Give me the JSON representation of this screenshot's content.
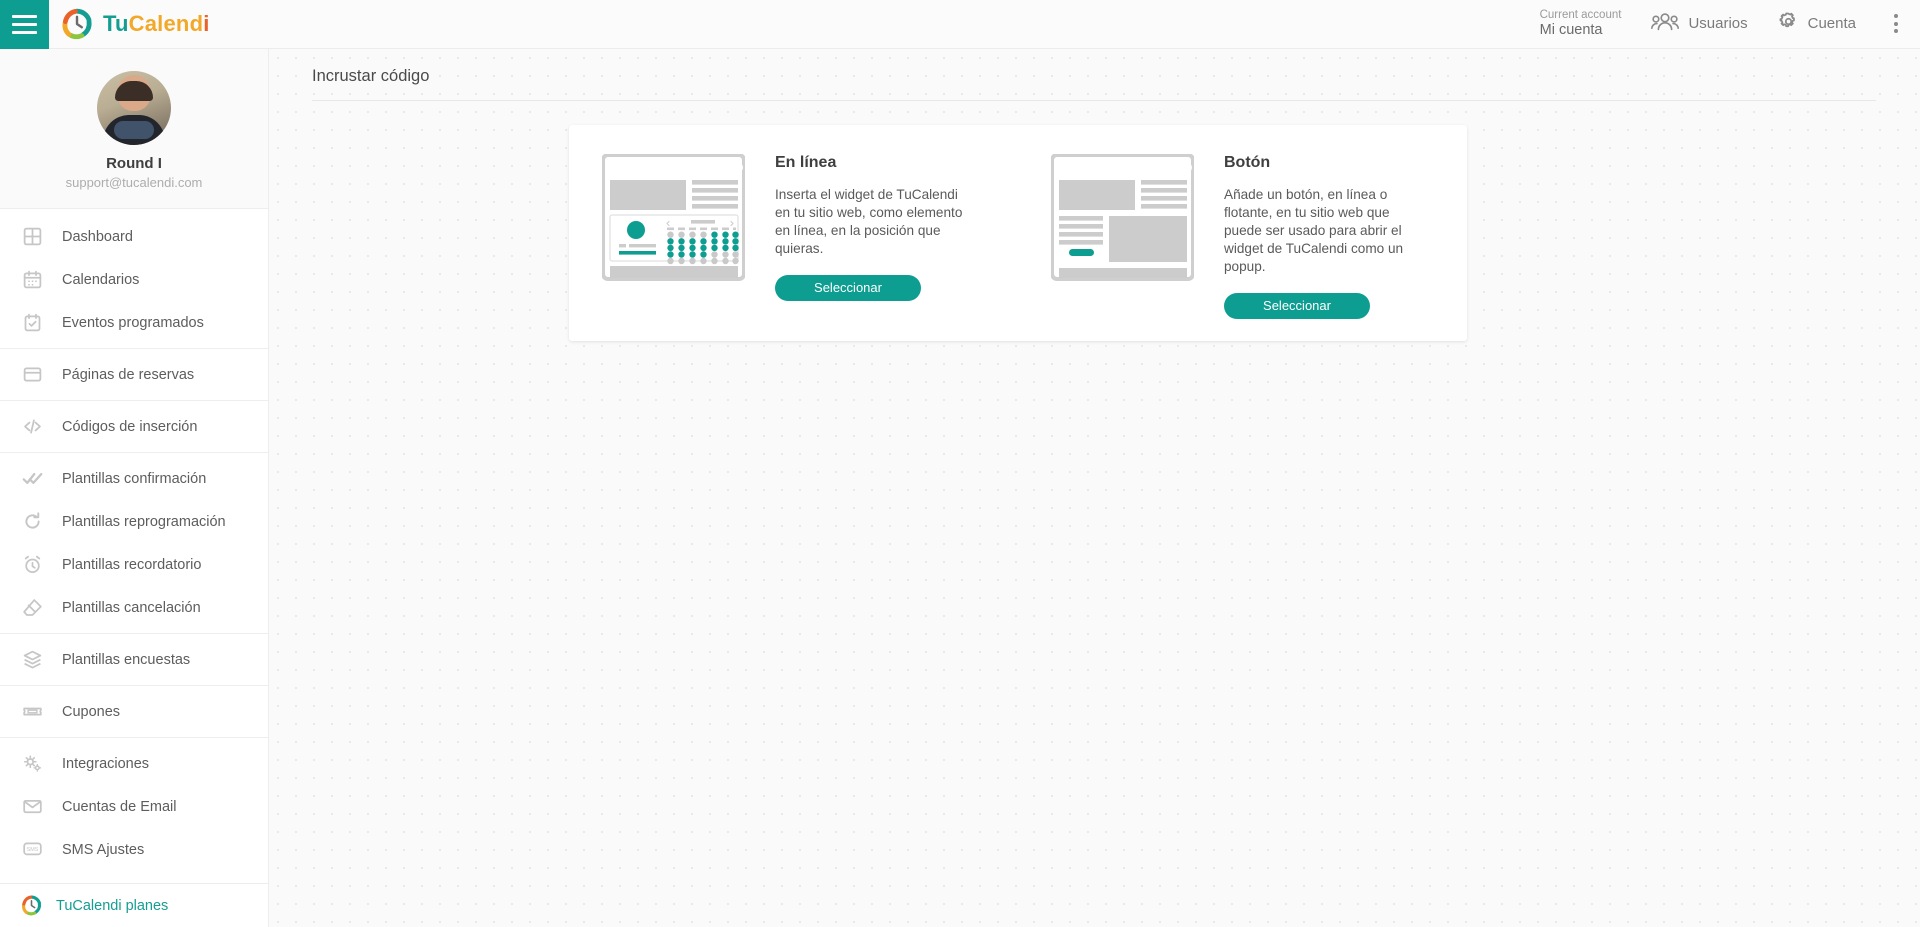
{
  "app": {
    "brand_tu": "Tu",
    "brand_calend": "Calend",
    "brand_i": "i",
    "accent_teal": "#0d9e91",
    "accent_orange": "#e8622a",
    "accent_yellow": "#f2a92a",
    "accent_green": "#8cc63f"
  },
  "topbar": {
    "menu_icon": "hamburger-icon",
    "logo_icon": "tucalendi-logo-icon",
    "current_account_label": "Current account",
    "current_account_value": "Mi cuenta",
    "users_label": "Usuarios",
    "users_icon": "users-icon",
    "account_label": "Cuenta",
    "account_icon": "gear-icon",
    "more_icon": "kebab-menu-icon"
  },
  "sidebar": {
    "profile": {
      "avatar_icon": "user-avatar",
      "name": "Round I",
      "email": "support@tucalendi.com"
    },
    "groups": [
      {
        "items": [
          {
            "label": "Dashboard",
            "icon": "dashboard-grid-icon"
          },
          {
            "label": "Calendarios",
            "icon": "calendar-icon"
          },
          {
            "label": "Eventos programados",
            "icon": "calendar-check-icon"
          }
        ]
      },
      {
        "items": [
          {
            "label": "Páginas de reservas",
            "icon": "window-icon"
          }
        ]
      },
      {
        "items": [
          {
            "label": "Códigos de inserción",
            "icon": "code-icon"
          }
        ]
      },
      {
        "items": [
          {
            "label": "Plantillas confirmación",
            "icon": "double-check-icon"
          },
          {
            "label": "Plantillas reprogramación",
            "icon": "refresh-icon"
          },
          {
            "label": "Plantillas recordatorio",
            "icon": "alarm-clock-icon"
          },
          {
            "label": "Plantillas cancelación",
            "icon": "eraser-icon"
          }
        ]
      },
      {
        "items": [
          {
            "label": "Plantillas encuestas",
            "icon": "layers-icon"
          }
        ]
      },
      {
        "items": [
          {
            "label": "Cupones",
            "icon": "ticket-icon"
          }
        ]
      },
      {
        "items": [
          {
            "label": "Integraciones",
            "icon": "cogs-icon"
          },
          {
            "label": "Cuentas de Email",
            "icon": "envelope-icon"
          },
          {
            "label": "SMS Ajustes",
            "icon": "sms-icon"
          }
        ]
      }
    ],
    "footer": {
      "label": "TuCalendi planes",
      "icon": "tucalendi-logo-icon"
    }
  },
  "main": {
    "page_title": "Incrustar código",
    "options": [
      {
        "title": "En línea",
        "description": "Inserta el widget de TuCalendi en tu sitio web, como elemento en línea, en la posición que quieras.",
        "button_label": "Seleccionar",
        "thumb_icon": "inline-widget-preview"
      },
      {
        "title": "Botón",
        "description": "Añade un botón, en línea o flotante, en tu sitio web que puede ser usado para abrir el widget de TuCalendi como un popup.",
        "button_label": "Seleccionar",
        "thumb_icon": "button-widget-preview"
      }
    ]
  }
}
